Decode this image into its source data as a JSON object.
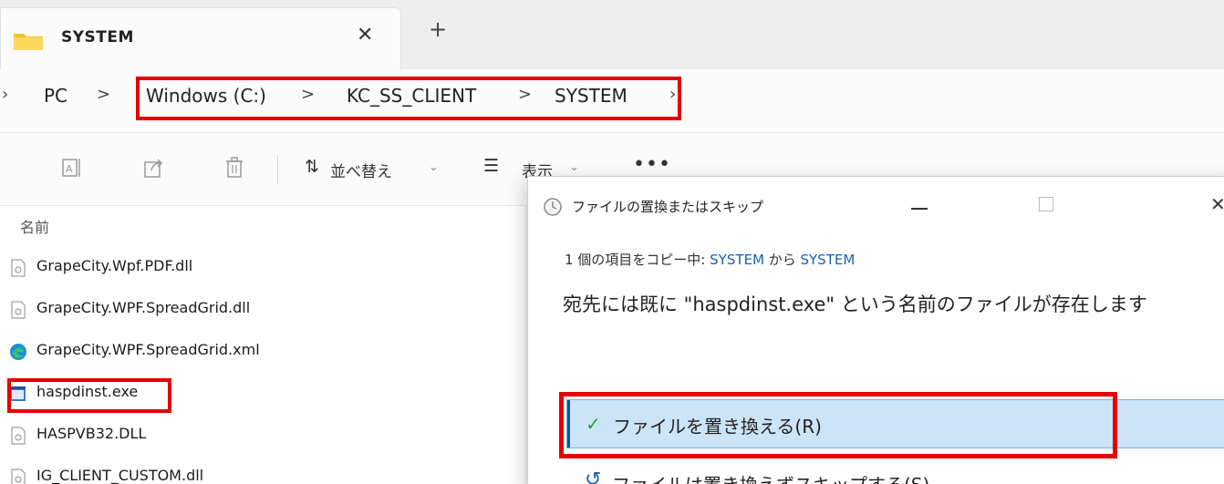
{
  "tab": {
    "title": "SYSTEM",
    "close": "✕",
    "new_tab": "+"
  },
  "address": {
    "left_chevron": "›",
    "crumbs": [
      "PC",
      "Windows (C:)",
      "KC_SS_CLIENT",
      "SYSTEM"
    ],
    "separator": ">",
    "trailing": "›"
  },
  "commandbar": {
    "sort_icon": "⇅",
    "sort_label": "並べ替え",
    "view_icon": "☰",
    "view_label": "表示",
    "dropdown": "⌄",
    "more": "•••"
  },
  "filelist": {
    "column_name": "名前",
    "files": [
      {
        "name": "GrapeCity.Wpf.PDF.dll",
        "icon": "dll-file-icon"
      },
      {
        "name": "GrapeCity.WPF.SpreadGrid.dll",
        "icon": "dll-file-icon"
      },
      {
        "name": "GrapeCity.WPF.SpreadGrid.xml",
        "icon": "edge-xml-icon"
      },
      {
        "name": "haspdinst.exe",
        "icon": "exe-file-icon"
      },
      {
        "name": "HASPVB32.DLL",
        "icon": "dll-file-icon"
      },
      {
        "name": "IG_CLIENT_CUSTOM.dll",
        "icon": "dll-file-icon"
      }
    ]
  },
  "dialog": {
    "title": "ファイルの置換またはスキップ",
    "close": "✕",
    "copy_prefix": "1 個の項目をコピー中: ",
    "copy_source": "SYSTEM",
    "copy_middle": " から ",
    "copy_dest": "SYSTEM",
    "message": "宛先には既に \"haspdinst.exe\" という名前のファイルが存在します",
    "replace_check": "✓",
    "replace_label": "ファイルを置き換える(R)",
    "skip_icon": "↺",
    "skip_label": "ファイルは置き換えずスキップする(S)"
  },
  "colors": {
    "highlight": "#e50000",
    "selected_option": "#cce4f7",
    "link": "#1a5fb4"
  }
}
